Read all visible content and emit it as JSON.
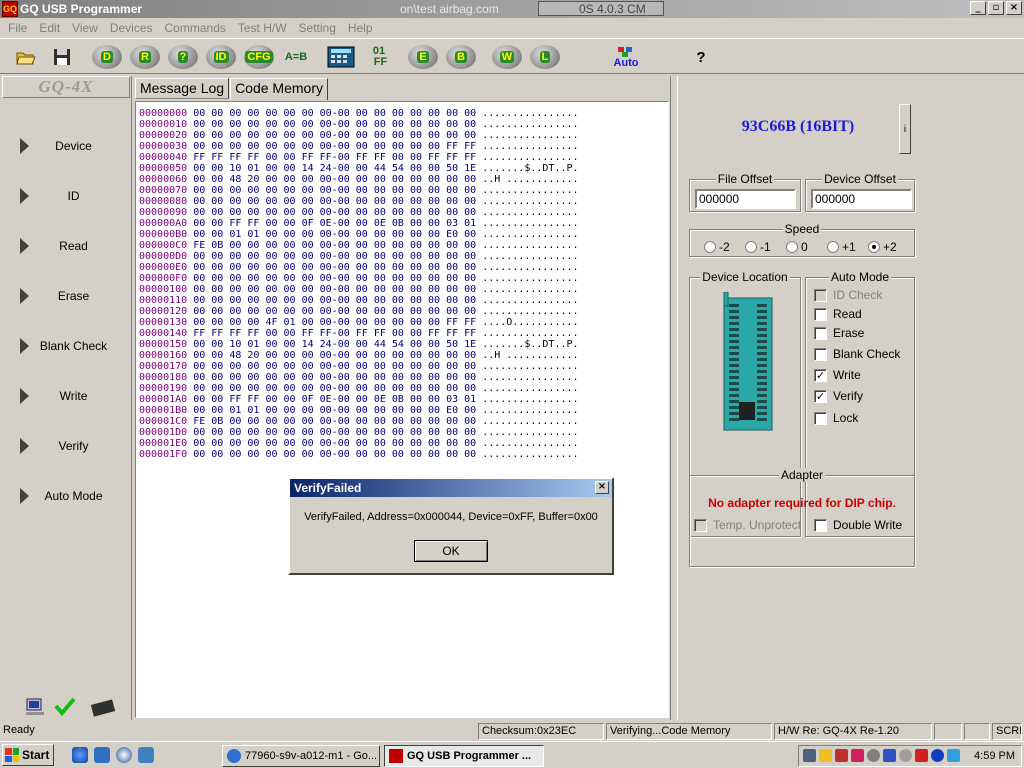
{
  "window": {
    "title": "GQ USB Programmer",
    "title_fragment": "on\\test airbag.com",
    "title_box_text": "0S 4.0.3 CM",
    "app_icon_text": "GQ",
    "minimize": "_",
    "maximize": "▫",
    "close": "×"
  },
  "menu": [
    "File",
    "Edit",
    "View",
    "Devices",
    "Commands",
    "Test H/W",
    "Setting",
    "Help"
  ],
  "toolbar": {
    "device": "D",
    "read": "R",
    "blank": "?",
    "id": "ID",
    "cfg": "CFG",
    "compare": "A=B",
    "fill": "01\n FF",
    "erase": "E",
    "blank_check": "B",
    "write": "W",
    "lock": "L",
    "auto": "Auto",
    "help": "?"
  },
  "left_nav": {
    "brand": "GQ-4X",
    "items": [
      "Device",
      "ID",
      "Read",
      "Erase",
      "Blank Check",
      "Write",
      "Verify",
      "Auto Mode"
    ]
  },
  "tabs": [
    "Message Log",
    "Code Memory"
  ],
  "hex_rows": [
    {
      "addr": "00000000",
      "bytes": "00 00 00 00 00 00 00 00-00 00 00 00 00 00 00 00",
      "ascii": "................"
    },
    {
      "addr": "00000010",
      "bytes": "00 00 00 00 00 00 00 00-00 00 00 00 00 00 00 00",
      "ascii": "................"
    },
    {
      "addr": "00000020",
      "bytes": "00 00 00 00 00 00 00 00-00 00 00 00 00 00 00 00",
      "ascii": "................"
    },
    {
      "addr": "00000030",
      "bytes": "00 00 00 00 00 00 00 00-00 00 00 00 00 00 FF FF",
      "ascii": "................"
    },
    {
      "addr": "00000040",
      "bytes": "FF FF FF FF 00 00 FF FF-00 FF FF 00 00 FF FF FF",
      "ascii": "................"
    },
    {
      "addr": "00000050",
      "bytes": "00 00 10 01 00 00 14 24-00 00 44 54 00 00 50 1E",
      "ascii": ".......$..DT..P."
    },
    {
      "addr": "00000060",
      "bytes": "00 00 48 20 00 00 00 00-00 00 00 00 00 00 00 00",
      "ascii": "..H ............"
    },
    {
      "addr": "00000070",
      "bytes": "00 00 00 00 00 00 00 00-00 00 00 00 00 00 00 00",
      "ascii": "................"
    },
    {
      "addr": "00000080",
      "bytes": "00 00 00 00 00 00 00 00-00 00 00 00 00 00 00 00",
      "ascii": "................"
    },
    {
      "addr": "00000090",
      "bytes": "00 00 00 00 00 00 00 00-00 00 00 00 00 00 00 00",
      "ascii": "................"
    },
    {
      "addr": "000000A0",
      "bytes": "00 00 FF FF 00 00 0F 0E-00 00 0E 0B 00 00 03 01",
      "ascii": "................"
    },
    {
      "addr": "000000B0",
      "bytes": "00 00 01 01 00 00 00 00-00 00 00 00 00 00 E0 00",
      "ascii": "................"
    },
    {
      "addr": "000000C0",
      "bytes": "FE 0B 00 00 00 00 00 00-00 00 00 00 00 00 00 00",
      "ascii": "................"
    },
    {
      "addr": "000000D0",
      "bytes": "00 00 00 00 00 00 00 00-00 00 00 00 00 00 00 00",
      "ascii": "................"
    },
    {
      "addr": "000000E0",
      "bytes": "00 00 00 00 00 00 00 00-00 00 00 00 00 00 00 00",
      "ascii": "................"
    },
    {
      "addr": "000000F0",
      "bytes": "00 00 00 00 00 00 00 00-00 00 00 00 00 00 00 00",
      "ascii": "................"
    },
    {
      "addr": "00000100",
      "bytes": "00 00 00 00 00 00 00 00-00 00 00 00 00 00 00 00",
      "ascii": "................"
    },
    {
      "addr": "00000110",
      "bytes": "00 00 00 00 00 00 00 00-00 00 00 00 00 00 00 00",
      "ascii": "................"
    },
    {
      "addr": "00000120",
      "bytes": "00 00 00 00 00 00 00 00-00 00 00 00 00 00 00 00",
      "ascii": "................"
    },
    {
      "addr": "00000130",
      "bytes": "00 00 00 00 4F 01 00 00-00 00 00 00 00 00 FF FF",
      "ascii": "....O..........."
    },
    {
      "addr": "00000140",
      "bytes": "FF FF FF FF 00 00 FF FF-00 FF FF 00 00 FF FF FF",
      "ascii": "................"
    },
    {
      "addr": "00000150",
      "bytes": "00 00 10 01 00 00 14 24-00 00 44 54 00 00 50 1E",
      "ascii": ".......$..DT..P."
    },
    {
      "addr": "00000160",
      "bytes": "00 00 48 20 00 00 00 00-00 00 00 00 00 00 00 00",
      "ascii": "..H ............"
    },
    {
      "addr": "00000170",
      "bytes": "00 00 00 00 00 00 00 00-00 00 00 00 00 00 00 00",
      "ascii": "................"
    },
    {
      "addr": "00000180",
      "bytes": "00 00 00 00 00 00 00 00-00 00 00 00 00 00 00 00",
      "ascii": "................"
    },
    {
      "addr": "00000190",
      "bytes": "00 00 00 00 00 00 00 00-00 00 00 00 00 00 00 00",
      "ascii": "................"
    },
    {
      "addr": "000001A0",
      "bytes": "00 00 FF FF 00 00 0F 0E-00 00 0E 0B 00 00 03 01",
      "ascii": "................"
    },
    {
      "addr": "000001B0",
      "bytes": "00 00 01 01 00 00 00 00-00 00 00 00 00 00 E0 00",
      "ascii": "................"
    },
    {
      "addr": "000001C0",
      "bytes": "FE 0B 00 00 00 00 00 00-00 00 00 00 00 00 00 00",
      "ascii": "................"
    },
    {
      "addr": "000001D0",
      "bytes": "00 00 00 00 00 00 00 00-00 00 00 00 00 00 00 00",
      "ascii": "................"
    },
    {
      "addr": "000001E0",
      "bytes": "00 00 00 00 00 00 00 00-00 00 00 00 00 00 00 00",
      "ascii": "................"
    },
    {
      "addr": "000001F0",
      "bytes": "00 00 00 00 00 00 00 00-00 00 00 00 00 00 00 00",
      "ascii": "................"
    }
  ],
  "right_panel": {
    "chip_name": "93C66B (16BIT)",
    "info_button": "i",
    "file_offset_label": "File Offset",
    "file_offset_value": "000000",
    "device_offset_label": "Device Offset",
    "device_offset_value": "000000",
    "speed_label": "Speed",
    "speed_options": [
      "-2",
      "-1",
      "0",
      "+1",
      "+2"
    ],
    "speed_selected": "+2",
    "device_location_label": "Device Location",
    "temp_unprotect": "Temp. Unprotect",
    "auto_mode_label": "Auto Mode",
    "auto_mode": [
      {
        "label": "ID Check",
        "checked": false,
        "disabled": true
      },
      {
        "label": "Read",
        "checked": false,
        "disabled": false
      },
      {
        "label": "Erase",
        "checked": false,
        "disabled": false
      },
      {
        "label": "Blank Check",
        "checked": false,
        "disabled": false
      },
      {
        "label": "Write",
        "checked": true,
        "disabled": false
      },
      {
        "label": "Verify",
        "checked": true,
        "disabled": false
      },
      {
        "label": "Lock",
        "checked": false,
        "disabled": false
      }
    ],
    "double_write": "Double Write",
    "adapter_label": "Adapter",
    "adapter_message": "No adapter required for DIP chip."
  },
  "dialog": {
    "title": "VerifyFailed",
    "message": "VerifyFailed, Address=0x000044, Device=0xFF, Buffer=0x00",
    "ok": "OK",
    "close": "×"
  },
  "statusbar": {
    "ready": "Ready",
    "checksum": "Checksum:0x23EC",
    "verifying": "Verifying...Code Memory",
    "hw": "H/W Re: GQ-4X Re-1.20",
    "scrl": "SCRL"
  },
  "taskbar": {
    "start": "Start",
    "task1": "77960-s9v-a012-m1 - Go...",
    "task2": "GQ USB Programmer ...",
    "clock": "4:59 PM"
  },
  "colors": {
    "chip_name": "#1a1adc",
    "adapter_message": "#cc0000",
    "hex_address": "#800080",
    "hex_bytes": "#000080",
    "zif_socket": "#2aa8a8"
  }
}
